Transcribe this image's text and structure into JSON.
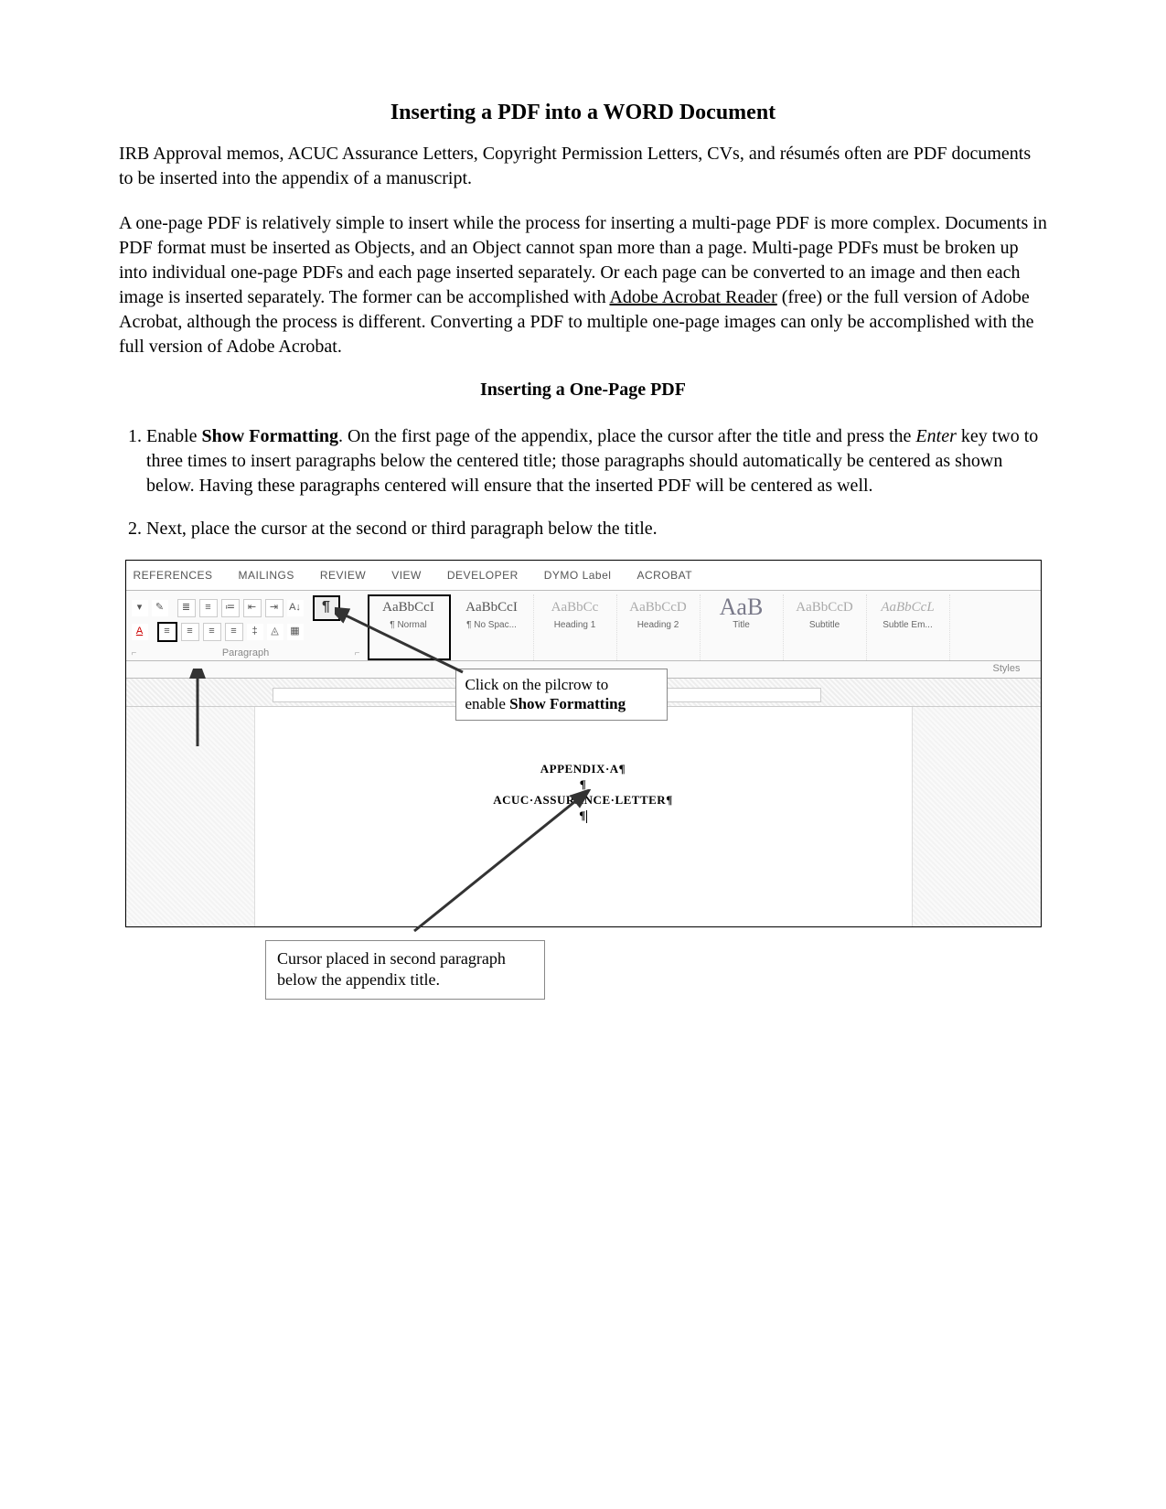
{
  "title": "Inserting a PDF into a WORD Document",
  "intro1": "IRB Approval memos, ACUC Assurance Letters, Copyright Permission Letters, CVs, and résumés often are PDF documents to be inserted into the appendix of a manuscript.",
  "intro2_before_link": "A one-page PDF is relatively simple to insert while the process for inserting a multi-page PDF is more complex. Documents in PDF format must be inserted as Objects, and an Object cannot span more than a page. Multi-page PDFs must be broken up into individual one-page PDFs and each page inserted separately. Or each page can be converted to an image and then each image is inserted separately. The former can be accomplished with ",
  "intro2_link": "Adobe Acrobat Reader",
  "intro2_after_link": " (free) or the full version of Adobe Acrobat, although the process is different. Converting a PDF to multiple one-page images can only be accomplished with the full version of Adobe Acrobat.",
  "subheading": "Inserting a One-Page PDF",
  "step1_lead": "Enable ",
  "step1_bold": "Show Formatting",
  "step1_rest_a": ". On the first page of the appendix, place the cursor after the title and press the ",
  "step1_italic": "Enter",
  "step1_rest_b": " key two to three times to insert paragraphs below the centered title; those paragraphs should automatically be centered as shown below. Having these paragraphs centered will ensure that the inserted PDF will be centered as well.",
  "step2": "Next, place the cursor at the second or third paragraph below the title.",
  "ribbon": {
    "tabs": [
      "REFERENCES",
      "MAILINGS",
      "REVIEW",
      "VIEW",
      "DEVELOPER",
      "DYMO Label",
      "ACROBAT"
    ],
    "pilcrow": "¶",
    "paragraph_group": "Paragraph",
    "styles_group": "Styles",
    "styles": [
      {
        "sample": "AaBbCcI",
        "name": "¶ Normal",
        "cls": "selected"
      },
      {
        "sample": "AaBbCcI",
        "name": "¶ No Spac..."
      },
      {
        "sample": "AaBbCc",
        "name": "Heading 1",
        "cls": "grey"
      },
      {
        "sample": "AaBbCcD",
        "name": "Heading 2",
        "cls": "grey"
      },
      {
        "sample": "AaB",
        "name": "Title",
        "cls": "big"
      },
      {
        "sample": "AaBbCcD",
        "name": "Subtitle",
        "cls": "grey"
      },
      {
        "sample": "AaBbCcL",
        "name": "Subtle Em...",
        "cls": "grey"
      }
    ]
  },
  "callout_pilcrow_a": "Click on the pilcrow to",
  "callout_pilcrow_b1": "enable ",
  "callout_pilcrow_b2": "Show Formatting",
  "doc": {
    "line1": "APPENDIX·A¶",
    "line2": "¶",
    "line3": "ACUC·ASSURANCE·LETTER¶",
    "line4": "¶"
  },
  "callout_cursor": "Cursor placed in second paragraph below the appendix title."
}
